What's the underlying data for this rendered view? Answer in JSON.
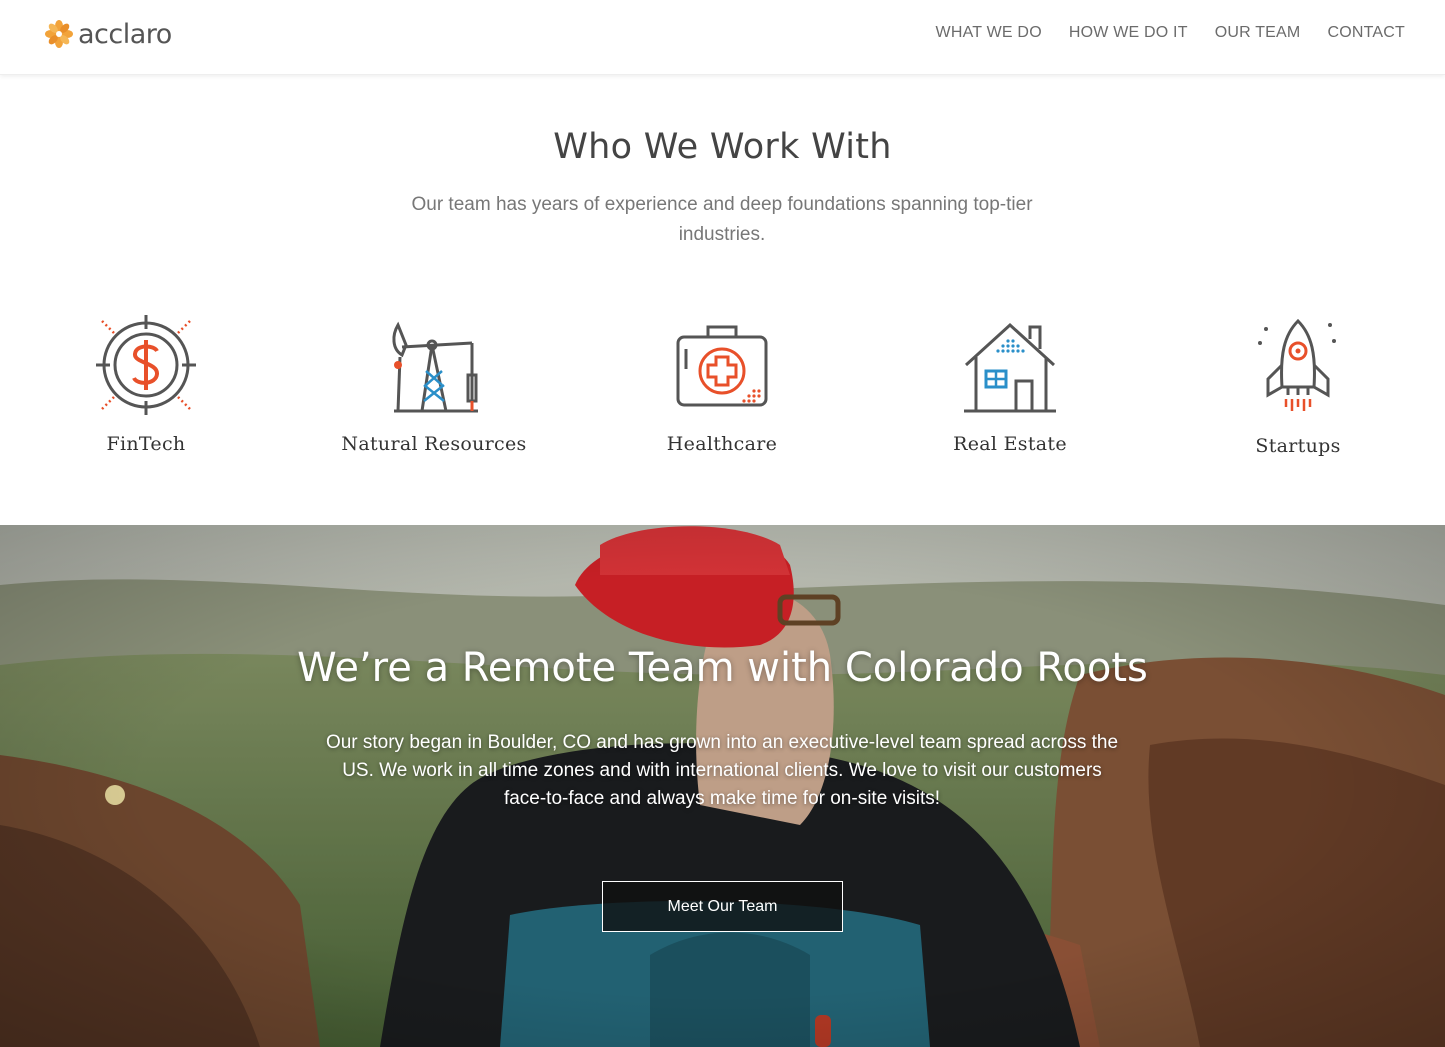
{
  "header": {
    "logo_text": "acclaro",
    "logo_icon": "flower-logo-icon",
    "nav": [
      {
        "label": "WHAT WE DO"
      },
      {
        "label": "HOW WE DO IT"
      },
      {
        "label": "OUR TEAM"
      },
      {
        "label": "CONTACT"
      }
    ]
  },
  "who": {
    "title": "Who We Work With",
    "subtitle": "Our team has years of experience and deep foundations spanning top-tier industries.",
    "industries": [
      {
        "label": "FinTech",
        "icon": "dollar-target-icon"
      },
      {
        "label": "Natural Resources",
        "icon": "oil-pump-icon"
      },
      {
        "label": "Healthcare",
        "icon": "medical-kit-icon"
      },
      {
        "label": "Real Estate",
        "icon": "house-icon"
      },
      {
        "label": "Startups",
        "icon": "rocket-icon"
      }
    ]
  },
  "hero": {
    "title": "We’re a Remote Team with Colorado Roots",
    "text": "Our story began in Boulder, CO and has grown into an executive-level team spread across the US. We work in all time zones and with international clients. We love to visit our customers face-to-face and always make time for on-site visits!",
    "button_label": "Meet Our Team"
  },
  "colors": {
    "accent_orange": "#e8502a",
    "logo_orange": "#f2a33a",
    "icon_gray": "#555555",
    "icon_blue": "#2a8fc9"
  }
}
